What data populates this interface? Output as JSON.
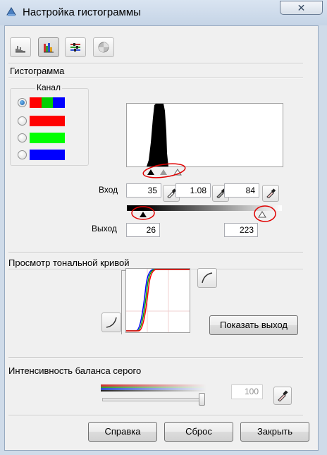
{
  "window": {
    "title": "Настройка гистограммы",
    "close_glyph": "✕"
  },
  "toolbar": {
    "buttons": [
      "histogram-icon",
      "histogram-color-icon",
      "tone-adjust-icon",
      "saturation-icon"
    ]
  },
  "histogram_section": {
    "title": "Гистограмма",
    "channel": {
      "label": "Канал",
      "options": [
        {
          "name": "rgb",
          "colors": [
            "#ff0000",
            "#00d000",
            "#0000ff"
          ],
          "checked": true
        },
        {
          "name": "red",
          "colors": [
            "#ff0000"
          ],
          "checked": false
        },
        {
          "name": "green",
          "colors": [
            "#00ff00"
          ],
          "checked": false
        },
        {
          "name": "blue",
          "colors": [
            "#0000ff"
          ],
          "checked": false
        }
      ]
    },
    "input": {
      "label": "Вход",
      "black": "35",
      "gamma": "1.08",
      "white": "84"
    },
    "output": {
      "label": "Выход",
      "black": "26",
      "white": "223"
    }
  },
  "tone_curve": {
    "title": "Просмотр тональной кривой",
    "show_output_button": "Показать выход"
  },
  "gray_balance": {
    "title": "Интенсивность баланса серого",
    "value": "100",
    "level": 1.0
  },
  "buttons": {
    "help": "Справка",
    "reset": "Сброс",
    "close": "Закрыть"
  },
  "colors": {
    "annotation": "#e00000",
    "accent": "#1a5fa8"
  }
}
